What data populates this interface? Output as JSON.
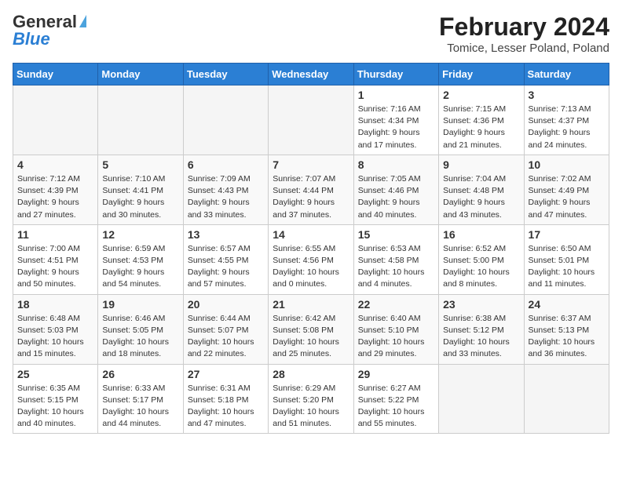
{
  "header": {
    "logo_line1": "General",
    "logo_line2": "Blue",
    "month_title": "February 2024",
    "location": "Tomice, Lesser Poland, Poland"
  },
  "weekdays": [
    "Sunday",
    "Monday",
    "Tuesday",
    "Wednesday",
    "Thursday",
    "Friday",
    "Saturday"
  ],
  "weeks": [
    [
      {
        "day": "",
        "info": ""
      },
      {
        "day": "",
        "info": ""
      },
      {
        "day": "",
        "info": ""
      },
      {
        "day": "",
        "info": ""
      },
      {
        "day": "1",
        "info": "Sunrise: 7:16 AM\nSunset: 4:34 PM\nDaylight: 9 hours\nand 17 minutes."
      },
      {
        "day": "2",
        "info": "Sunrise: 7:15 AM\nSunset: 4:36 PM\nDaylight: 9 hours\nand 21 minutes."
      },
      {
        "day": "3",
        "info": "Sunrise: 7:13 AM\nSunset: 4:37 PM\nDaylight: 9 hours\nand 24 minutes."
      }
    ],
    [
      {
        "day": "4",
        "info": "Sunrise: 7:12 AM\nSunset: 4:39 PM\nDaylight: 9 hours\nand 27 minutes."
      },
      {
        "day": "5",
        "info": "Sunrise: 7:10 AM\nSunset: 4:41 PM\nDaylight: 9 hours\nand 30 minutes."
      },
      {
        "day": "6",
        "info": "Sunrise: 7:09 AM\nSunset: 4:43 PM\nDaylight: 9 hours\nand 33 minutes."
      },
      {
        "day": "7",
        "info": "Sunrise: 7:07 AM\nSunset: 4:44 PM\nDaylight: 9 hours\nand 37 minutes."
      },
      {
        "day": "8",
        "info": "Sunrise: 7:05 AM\nSunset: 4:46 PM\nDaylight: 9 hours\nand 40 minutes."
      },
      {
        "day": "9",
        "info": "Sunrise: 7:04 AM\nSunset: 4:48 PM\nDaylight: 9 hours\nand 43 minutes."
      },
      {
        "day": "10",
        "info": "Sunrise: 7:02 AM\nSunset: 4:49 PM\nDaylight: 9 hours\nand 47 minutes."
      }
    ],
    [
      {
        "day": "11",
        "info": "Sunrise: 7:00 AM\nSunset: 4:51 PM\nDaylight: 9 hours\nand 50 minutes."
      },
      {
        "day": "12",
        "info": "Sunrise: 6:59 AM\nSunset: 4:53 PM\nDaylight: 9 hours\nand 54 minutes."
      },
      {
        "day": "13",
        "info": "Sunrise: 6:57 AM\nSunset: 4:55 PM\nDaylight: 9 hours\nand 57 minutes."
      },
      {
        "day": "14",
        "info": "Sunrise: 6:55 AM\nSunset: 4:56 PM\nDaylight: 10 hours\nand 0 minutes."
      },
      {
        "day": "15",
        "info": "Sunrise: 6:53 AM\nSunset: 4:58 PM\nDaylight: 10 hours\nand 4 minutes."
      },
      {
        "day": "16",
        "info": "Sunrise: 6:52 AM\nSunset: 5:00 PM\nDaylight: 10 hours\nand 8 minutes."
      },
      {
        "day": "17",
        "info": "Sunrise: 6:50 AM\nSunset: 5:01 PM\nDaylight: 10 hours\nand 11 minutes."
      }
    ],
    [
      {
        "day": "18",
        "info": "Sunrise: 6:48 AM\nSunset: 5:03 PM\nDaylight: 10 hours\nand 15 minutes."
      },
      {
        "day": "19",
        "info": "Sunrise: 6:46 AM\nSunset: 5:05 PM\nDaylight: 10 hours\nand 18 minutes."
      },
      {
        "day": "20",
        "info": "Sunrise: 6:44 AM\nSunset: 5:07 PM\nDaylight: 10 hours\nand 22 minutes."
      },
      {
        "day": "21",
        "info": "Sunrise: 6:42 AM\nSunset: 5:08 PM\nDaylight: 10 hours\nand 25 minutes."
      },
      {
        "day": "22",
        "info": "Sunrise: 6:40 AM\nSunset: 5:10 PM\nDaylight: 10 hours\nand 29 minutes."
      },
      {
        "day": "23",
        "info": "Sunrise: 6:38 AM\nSunset: 5:12 PM\nDaylight: 10 hours\nand 33 minutes."
      },
      {
        "day": "24",
        "info": "Sunrise: 6:37 AM\nSunset: 5:13 PM\nDaylight: 10 hours\nand 36 minutes."
      }
    ],
    [
      {
        "day": "25",
        "info": "Sunrise: 6:35 AM\nSunset: 5:15 PM\nDaylight: 10 hours\nand 40 minutes."
      },
      {
        "day": "26",
        "info": "Sunrise: 6:33 AM\nSunset: 5:17 PM\nDaylight: 10 hours\nand 44 minutes."
      },
      {
        "day": "27",
        "info": "Sunrise: 6:31 AM\nSunset: 5:18 PM\nDaylight: 10 hours\nand 47 minutes."
      },
      {
        "day": "28",
        "info": "Sunrise: 6:29 AM\nSunset: 5:20 PM\nDaylight: 10 hours\nand 51 minutes."
      },
      {
        "day": "29",
        "info": "Sunrise: 6:27 AM\nSunset: 5:22 PM\nDaylight: 10 hours\nand 55 minutes."
      },
      {
        "day": "",
        "info": ""
      },
      {
        "day": "",
        "info": ""
      }
    ]
  ]
}
